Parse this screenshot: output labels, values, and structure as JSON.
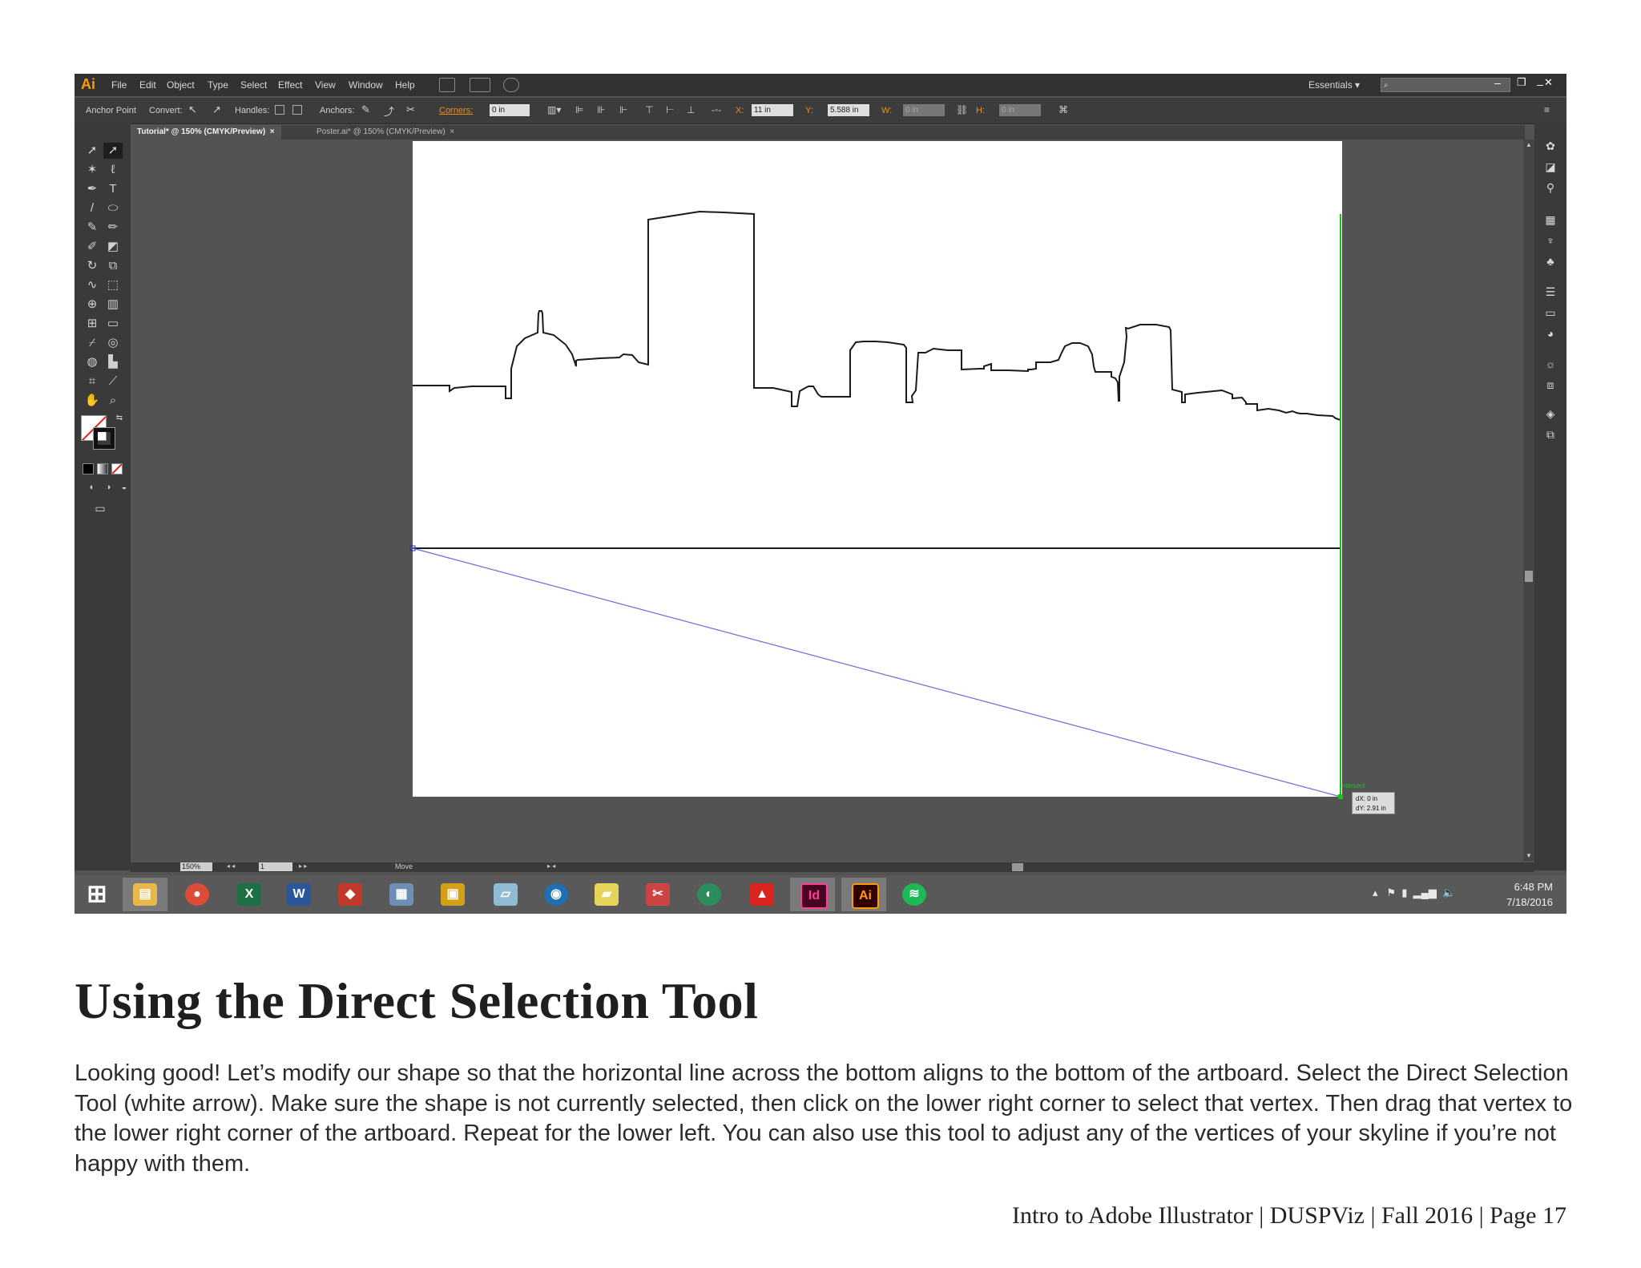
{
  "app": {
    "logo": "Ai",
    "menu": [
      "File",
      "Edit",
      "Object",
      "Type",
      "Select",
      "Effect",
      "View",
      "Window",
      "Help"
    ],
    "workspace": "Essentials",
    "window_controls": [
      "–",
      "❐",
      "✕"
    ]
  },
  "control_bar": {
    "anchor_point": "Anchor Point",
    "convert": "Convert:",
    "handles": "Handles:",
    "anchors": "Anchors:",
    "corners": "Corners:",
    "corners_value": "0 in",
    "x_label": "X:",
    "x_value": "11 in",
    "y_label": "Y:",
    "y_value": "5.588 in",
    "w_label": "W:",
    "w_value": "0 in",
    "h_label": "H:",
    "h_value": "0 in"
  },
  "tabs": [
    {
      "label": "Tutorial* @ 150% (CMYK/Preview)",
      "close": "×"
    },
    {
      "label": "Poster.ai* @ 150% (CMYK/Preview)",
      "close": "×"
    }
  ],
  "status": {
    "zoom": "150%",
    "page": "1",
    "tool": "Move"
  },
  "canvas": {
    "snap_label": "intersect",
    "dx": "dX: 0 in",
    "dy": "dY: 2.91 in"
  },
  "taskbar": {
    "apps": [
      {
        "icon": "windows-start-icon",
        "glyph": "⊞",
        "color": "#ffffff"
      },
      {
        "icon": "file-explorer-icon",
        "glyph": "▤",
        "color": "#e8b84a"
      },
      {
        "icon": "chrome-icon",
        "glyph": "●",
        "color": "#dd4b39"
      },
      {
        "icon": "excel-icon",
        "glyph": "X",
        "color": "#1d7044"
      },
      {
        "icon": "word-icon",
        "glyph": "W",
        "color": "#2b579a"
      },
      {
        "icon": "cube-app-icon",
        "glyph": "◆",
        "color": "#c0392b"
      },
      {
        "icon": "calculator-icon",
        "glyph": "▦",
        "color": "#6e8fb5"
      },
      {
        "icon": "package-app-icon",
        "glyph": "▣",
        "color": "#d4a017"
      },
      {
        "icon": "notes-app-icon",
        "glyph": "▱",
        "color": "#8fbcd4"
      },
      {
        "icon": "search-app-icon",
        "glyph": "◉",
        "color": "#1f6fb2"
      },
      {
        "icon": "sticky-notes-icon",
        "glyph": "▰",
        "color": "#e6d35a"
      },
      {
        "icon": "snipping-tool-icon",
        "glyph": "✂",
        "color": "#c44"
      },
      {
        "icon": "network-app-icon",
        "glyph": "◐",
        "color": "#2a8d5b"
      },
      {
        "icon": "acrobat-icon",
        "glyph": "▲",
        "color": "#d9241f"
      },
      {
        "icon": "indesign-icon",
        "glyph": "Id",
        "color": "#49021f"
      },
      {
        "icon": "illustrator-icon",
        "glyph": "Ai",
        "color": "#330000"
      },
      {
        "icon": "spotify-icon",
        "glyph": "≋",
        "color": "#1db954"
      }
    ],
    "time": "6:48 PM",
    "date": "7/18/2016"
  },
  "document": {
    "heading": "Using the Direct Selection Tool",
    "body": "Looking good! Let’s modify our shape so that the horizontal line across the bottom aligns to the bottom of the artboard. Select the Direct Selection Tool (white arrow). Make sure the shape is not currently selected, then click on the lower right corner to select that vertex. Then drag that vertex to the lower right corner of the artboard. Repeat for the lower left. You can also use this tool to adjust any of the vertices of your skyline if you’re not happy with them.",
    "footer": "Intro to Adobe Illustrator | DUSPViz | Fall 2016 | Page 17"
  }
}
